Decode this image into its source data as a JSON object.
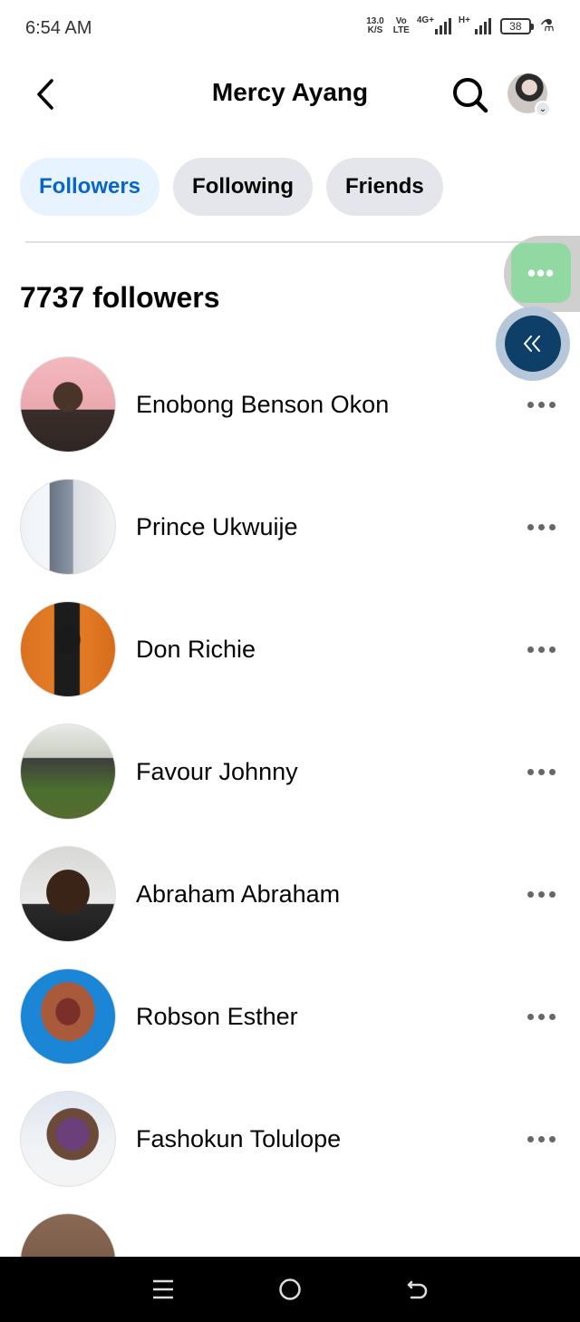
{
  "status_bar": {
    "time": "6:54 AM",
    "net_speed_value": "13.0",
    "net_speed_unit": "K/S",
    "volte_top": "Vo",
    "volte_bottom": "LTE",
    "signal1_tag": "4G+",
    "signal2_tag": "H+",
    "battery": "38"
  },
  "header": {
    "title": "Mercy Ayang"
  },
  "tabs": [
    {
      "label": "Followers",
      "active": true
    },
    {
      "label": "Following",
      "active": false
    },
    {
      "label": "Friends",
      "active": false
    }
  ],
  "followers_count_label": "7737 followers",
  "followers": [
    {
      "name": "Enobong Benson Okon"
    },
    {
      "name": "Prince Ukwuije"
    },
    {
      "name": "Don Richie"
    },
    {
      "name": "Favour Johnny"
    },
    {
      "name": "Abraham Abraham"
    },
    {
      "name": "Robson Esther"
    },
    {
      "name": "Fashokun Tolulope"
    }
  ],
  "floating": {
    "chat_icon": "more-dots-icon",
    "collapse_icon": "double-chevron-left-icon"
  },
  "colors": {
    "active_tab_bg": "#e7f3ff",
    "active_tab_text": "#0866c7",
    "inactive_tab_bg": "#e4e6eb",
    "chat_bubble": "#91d8a3",
    "collapse_bubble": "#0d3f68"
  }
}
